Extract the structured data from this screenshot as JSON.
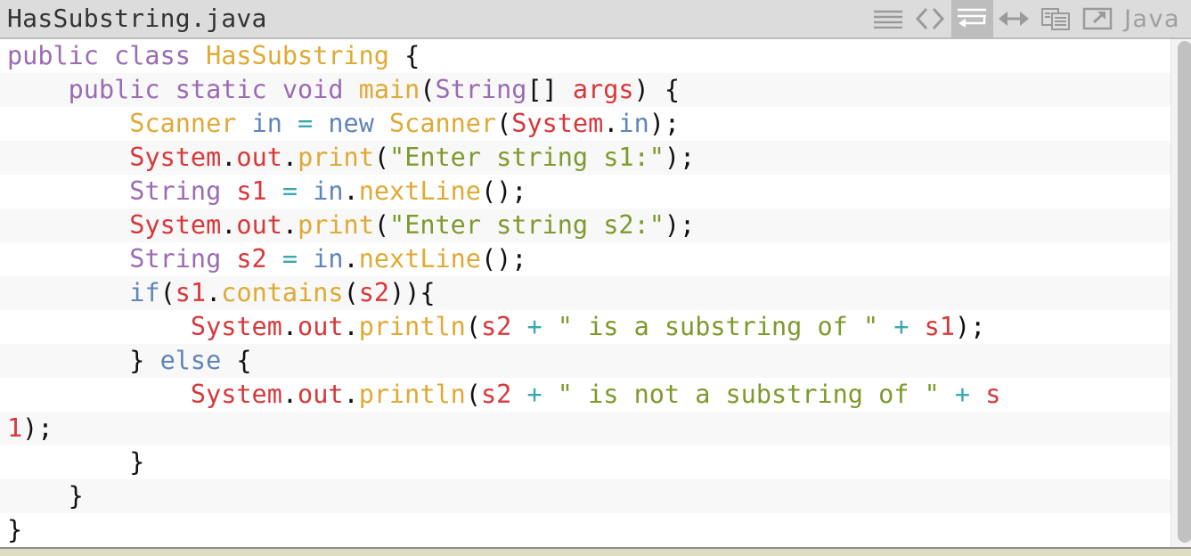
{
  "header": {
    "title": "HasSubstring.java",
    "language": "Java",
    "toolbar": [
      {
        "name": "view-lines",
        "icon": "lines-icon",
        "active": false
      },
      {
        "name": "view-source",
        "icon": "code-brackets-icon",
        "active": false
      },
      {
        "name": "wrap-lines",
        "icon": "wrap-icon",
        "active": true
      },
      {
        "name": "expand-width",
        "icon": "horizontal-arrows-icon",
        "active": false
      },
      {
        "name": "copy",
        "icon": "copy-icon",
        "active": false
      },
      {
        "name": "open-popout",
        "icon": "popout-icon",
        "active": false
      }
    ]
  },
  "colors": {
    "keyword": "#9b6bb3",
    "type": "#e0a934",
    "variable": "#d8373a",
    "builtin": "#5f85ba",
    "string": "#7e9a2c",
    "operator": "#3aa8b0",
    "header_bg": "#dcdcdc",
    "alt_row": "#f8f8f8"
  },
  "code": {
    "lines": [
      [
        [
          "kw",
          "public class "
        ],
        [
          "ty",
          "HasSubstring"
        ],
        [
          "pn",
          " {"
        ]
      ],
      [
        [
          "pn",
          "    "
        ],
        [
          "kw",
          "public static void "
        ],
        [
          "ty",
          "main"
        ],
        [
          "pn",
          "("
        ],
        [
          "kw",
          "String"
        ],
        [
          "pn",
          "[] "
        ],
        [
          "vr",
          "args"
        ],
        [
          "pn",
          ") {"
        ]
      ],
      [
        [
          "pn",
          "        "
        ],
        [
          "ty",
          "Scanner "
        ],
        [
          "bl",
          "in "
        ],
        [
          "op",
          "= "
        ],
        [
          "bl",
          "new "
        ],
        [
          "ty",
          "Scanner"
        ],
        [
          "pn",
          "("
        ],
        [
          "vr",
          "System"
        ],
        [
          "pn",
          "."
        ],
        [
          "bl",
          "in"
        ],
        [
          "pn",
          ");"
        ]
      ],
      [
        [
          "pn",
          "        "
        ],
        [
          "vr",
          "System"
        ],
        [
          "pn",
          "."
        ],
        [
          "vr",
          "out"
        ],
        [
          "pn",
          "."
        ],
        [
          "ty",
          "print"
        ],
        [
          "pn",
          "("
        ],
        [
          "st",
          "\"Enter string s1:\""
        ],
        [
          "pn",
          ");"
        ]
      ],
      [
        [
          "pn",
          "        "
        ],
        [
          "kw",
          "String "
        ],
        [
          "vr",
          "s1 "
        ],
        [
          "op",
          "= "
        ],
        [
          "bl",
          "in"
        ],
        [
          "pn",
          "."
        ],
        [
          "ty",
          "nextLine"
        ],
        [
          "pn",
          "();"
        ]
      ],
      [
        [
          "pn",
          "        "
        ],
        [
          "vr",
          "System"
        ],
        [
          "pn",
          "."
        ],
        [
          "vr",
          "out"
        ],
        [
          "pn",
          "."
        ],
        [
          "ty",
          "print"
        ],
        [
          "pn",
          "("
        ],
        [
          "st",
          "\"Enter string s2:\""
        ],
        [
          "pn",
          ");"
        ]
      ],
      [
        [
          "pn",
          "        "
        ],
        [
          "kw",
          "String "
        ],
        [
          "vr",
          "s2 "
        ],
        [
          "op",
          "= "
        ],
        [
          "bl",
          "in"
        ],
        [
          "pn",
          "."
        ],
        [
          "ty",
          "nextLine"
        ],
        [
          "pn",
          "();"
        ]
      ],
      [
        [
          "pn",
          "        "
        ],
        [
          "bl",
          "if"
        ],
        [
          "pn",
          "("
        ],
        [
          "vr",
          "s1"
        ],
        [
          "pn",
          "."
        ],
        [
          "ty",
          "contains"
        ],
        [
          "pn",
          "("
        ],
        [
          "vr",
          "s2"
        ],
        [
          "pn",
          "))"
        ],
        [
          "pn",
          "{"
        ]
      ],
      [
        [
          "pn",
          "            "
        ],
        [
          "vr",
          "System"
        ],
        [
          "pn",
          "."
        ],
        [
          "vr",
          "out"
        ],
        [
          "pn",
          "."
        ],
        [
          "ty",
          "println"
        ],
        [
          "pn",
          "("
        ],
        [
          "vr",
          "s2 "
        ],
        [
          "op",
          "+ "
        ],
        [
          "st",
          "\" is a substring of \" "
        ],
        [
          "op",
          "+ "
        ],
        [
          "vr",
          "s1"
        ],
        [
          "pn",
          ");"
        ]
      ],
      [
        [
          "pn",
          "        } "
        ],
        [
          "bl",
          "else "
        ],
        [
          "pn",
          "{"
        ]
      ],
      [
        [
          "pn",
          "            "
        ],
        [
          "vr",
          "System"
        ],
        [
          "pn",
          "."
        ],
        [
          "vr",
          "out"
        ],
        [
          "pn",
          "."
        ],
        [
          "ty",
          "println"
        ],
        [
          "pn",
          "("
        ],
        [
          "vr",
          "s2 "
        ],
        [
          "op",
          "+ "
        ],
        [
          "st",
          "\" is not a substring of \" "
        ],
        [
          "op",
          "+ "
        ],
        [
          "vr",
          "s"
        ]
      ],
      [
        [
          "vr",
          "1"
        ],
        [
          "pn",
          ");"
        ]
      ],
      [
        [
          "pn",
          "        }"
        ]
      ],
      [
        [
          "pn",
          "    }"
        ]
      ],
      [
        [
          "pn",
          "}"
        ]
      ]
    ]
  }
}
